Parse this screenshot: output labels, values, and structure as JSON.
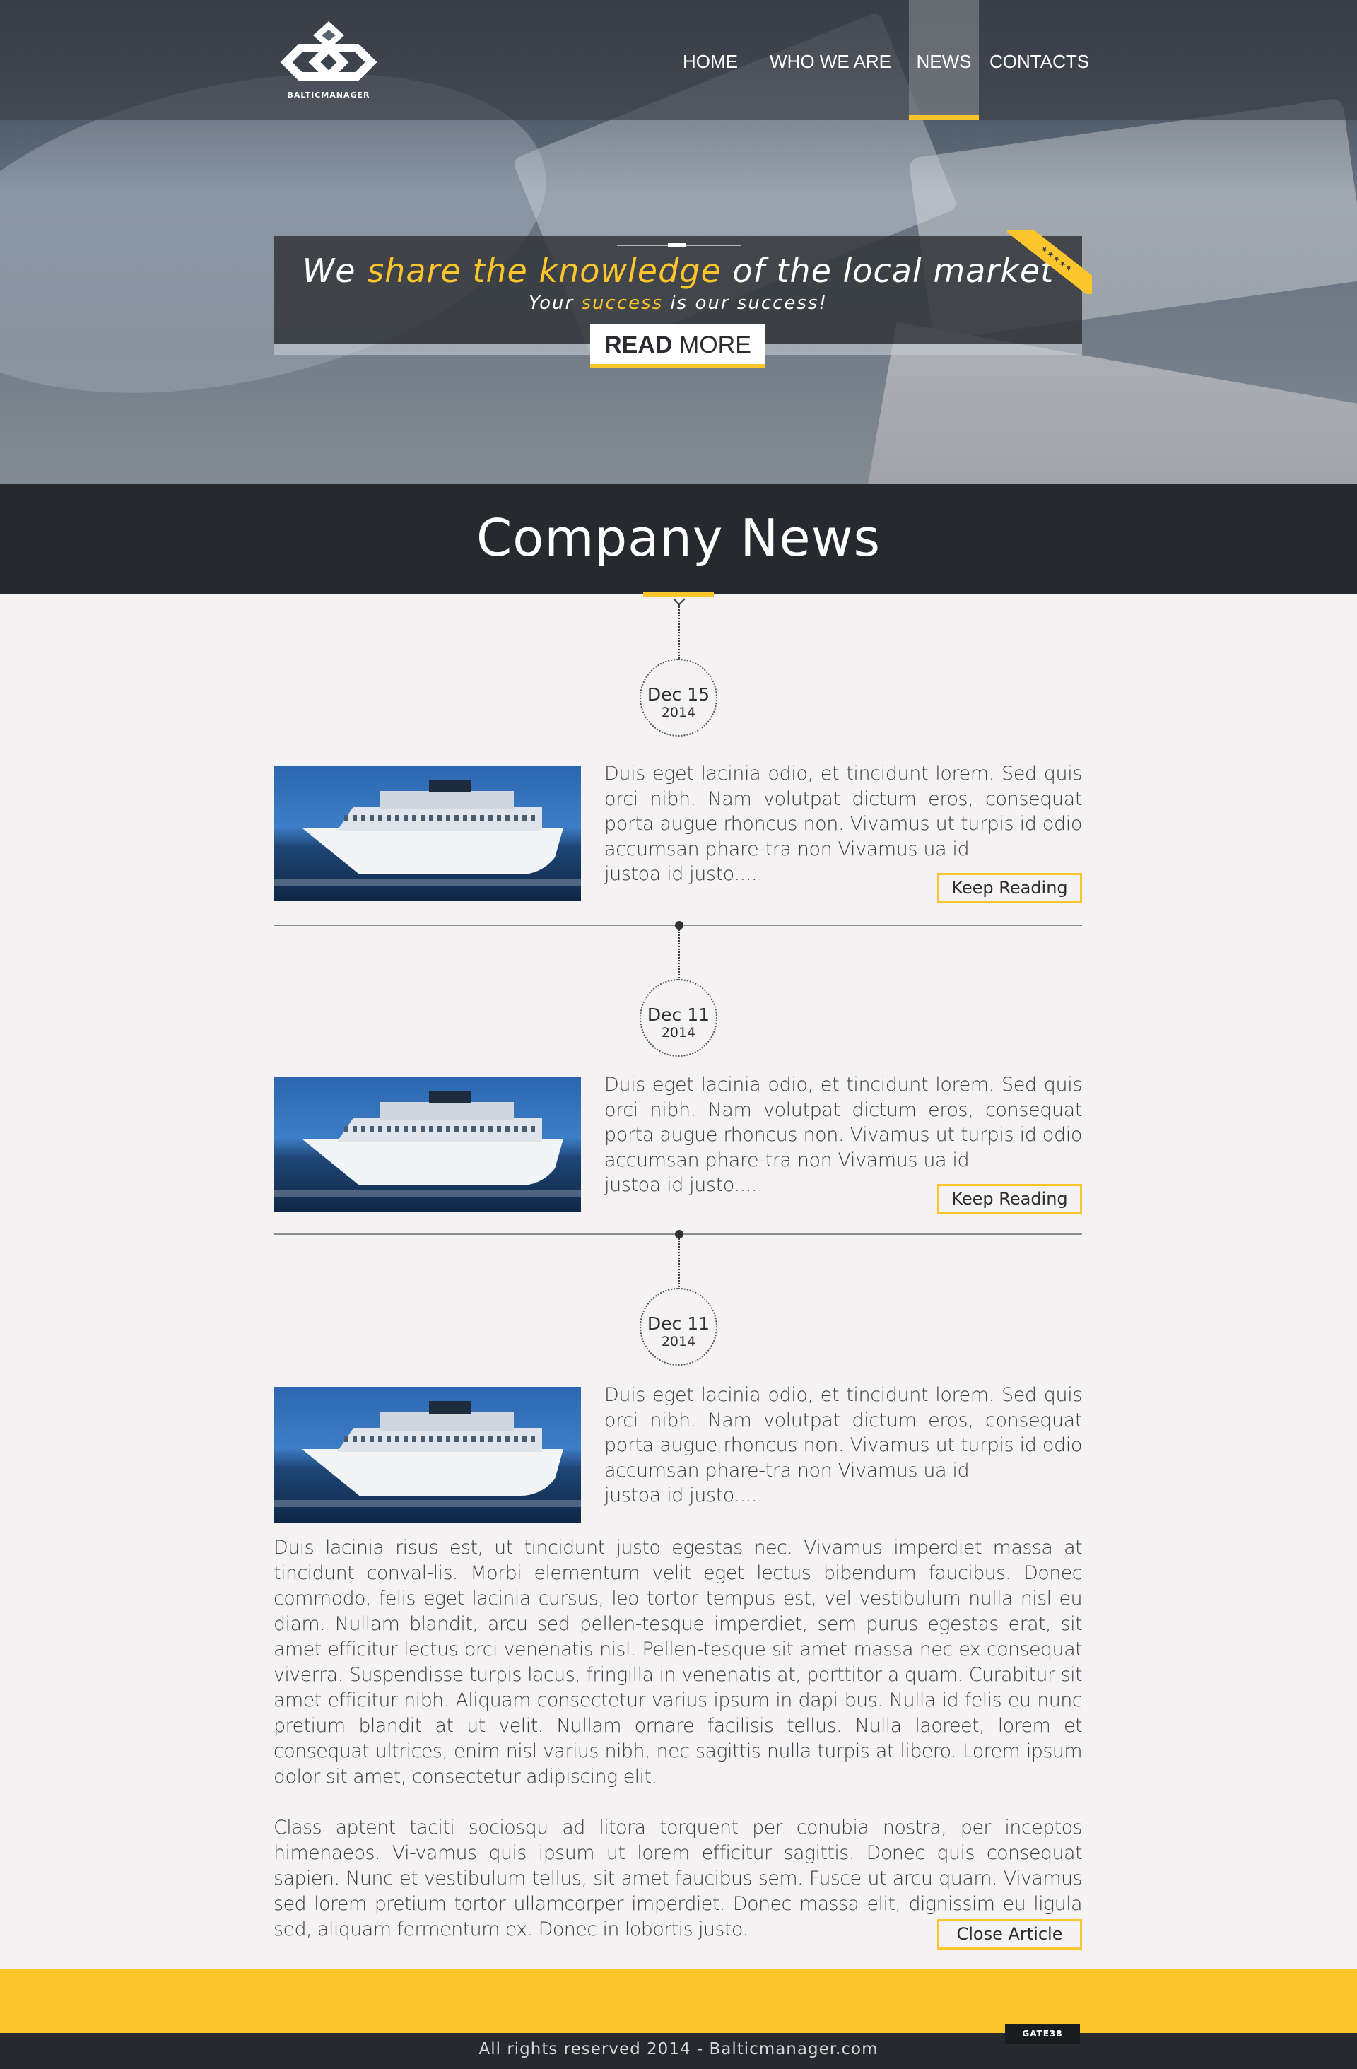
{
  "brand": {
    "logo_text": "BALTICMANAGER"
  },
  "nav": {
    "items": [
      {
        "label": "HOME",
        "active": false
      },
      {
        "label": "WHO WE ARE",
        "active": false
      },
      {
        "label": "NEWS",
        "active": true
      },
      {
        "label": "CONTACTS",
        "active": false
      }
    ]
  },
  "hero": {
    "headline_pre": "We ",
    "headline_highlight": "share the knowledge",
    "headline_post": " of the local market",
    "sub_pre": "Your ",
    "sub_highlight": "success",
    "sub_post": " is our success!",
    "ribbon_text": "★★★★★",
    "button_bold": "READ",
    "button_rest": " MORE"
  },
  "section": {
    "title": "Company News"
  },
  "articles": [
    {
      "date_day": "Dec 15",
      "date_year": "2014",
      "excerpt": "Duis eget lacinia odio, et tincidunt lorem. Sed quis orci nibh. Nam volutpat dictum eros, consequat porta augue rhoncus non. Vivamus ut turpis id odio accumsan phare-tra non Vivamus ua id",
      "excerpt_tail": "justoa id justo.....",
      "button_pre": "Keep ",
      "button_bold": "Reading"
    },
    {
      "date_day": "Dec 11",
      "date_year": "2014",
      "excerpt": "Duis eget lacinia odio, et tincidunt lorem. Sed quis orci nibh. Nam volutpat dictum eros, consequat porta augue rhoncus non. Vivamus ut turpis id odio accumsan phare-tra non Vivamus ua id",
      "excerpt_tail": "justoa id justo.....",
      "button_pre": "Keep ",
      "button_bold": "Reading"
    },
    {
      "date_day": "Dec 11",
      "date_year": "2014",
      "excerpt": "Duis eget lacinia odio, et tincidunt lorem. Sed quis orci nibh. Nam volutpat dictum eros, consequat porta augue rhoncus non. Vivamus ut turpis id odio accumsan phare-tra non Vivamus ua id",
      "excerpt_tail": "justoa id justo.....",
      "full_p1": "Duis lacinia risus est, ut tincidunt justo egestas nec. Vivamus imperdiet massa at tincidunt conval-lis. Morbi elementum velit eget lectus bibendum faucibus. Donec commodo, felis eget lacinia cursus, leo tortor tempus est, vel vestibulum nulla nisl eu diam. Nullam blandit, arcu sed pellen-tesque imperdiet, sem purus egestas erat, sit amet efficitur lectus orci venenatis nisl. Pellen-tesque sit amet massa nec ex consequat viverra. Suspendisse turpis lacus, fringilla in venenatis at, porttitor a quam. Curabitur sit amet efficitur nibh. Aliquam consectetur varius ipsum in dapi-bus. Nulla id felis eu nunc pretium blandit at ut velit. Nullam ornare facilisis tellus. Nulla laoreet, lorem et consequat ultrices, enim nisl varius nibh, nec sagittis nulla turpis at libero. Lorem ipsum dolor sit amet, consectetur adipiscing elit.",
      "full_p2": "Class aptent taciti sociosqu ad litora torquent per conubia nostra, per inceptos himenaeos. Vi-vamus quis ipsum ut lorem efficitur sagittis. Donec quis consequat sapien. Nunc et vestibulum tellus, sit amet faucibus sem. Fusce ut arcu quam. Vivamus sed lorem pretium tortor ullamcorper imperdiet. Donec massa elit, dignissim eu ligula sed, aliquam fermentum ex. Donec in lobortis justo.",
      "button_pre": "Close ",
      "button_bold": "Article"
    }
  ],
  "footer": {
    "copyright": "All rights reserved 2014 - Balticmanager.com",
    "badge": "GATE38"
  },
  "colors": {
    "accent": "#fbc52b",
    "dark": "#262a2e",
    "background": "#f4f2f2"
  }
}
